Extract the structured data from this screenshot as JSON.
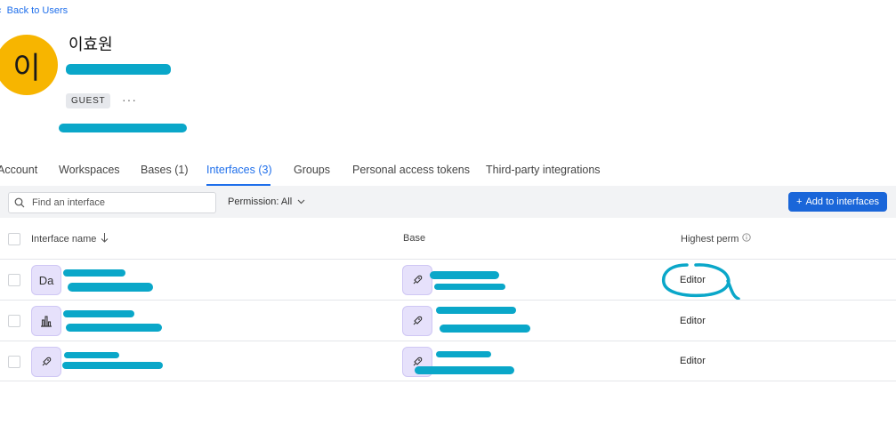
{
  "back_link": {
    "label": "Back to Users"
  },
  "user": {
    "avatar_initial": "이",
    "name": "이효원",
    "role_badge": "GUEST",
    "more_label": "···"
  },
  "tabs": [
    {
      "label": "Account"
    },
    {
      "label": "Workspaces"
    },
    {
      "label": "Bases (1)"
    },
    {
      "label": "Interfaces (3)",
      "active": true
    },
    {
      "label": "Groups"
    },
    {
      "label": "Personal access tokens"
    },
    {
      "label": "Third-party integrations"
    }
  ],
  "toolbar": {
    "search_placeholder": "Find an interface",
    "permission_filter": "Permission: All",
    "add_button": "Add to interfaces"
  },
  "table": {
    "headers": {
      "name": "Interface name",
      "base": "Base",
      "permission": "Highest perm"
    },
    "rows": [
      {
        "icon_text": "Da",
        "icon": "initials",
        "base_icon": "rocket-icon",
        "permission": "Editor"
      },
      {
        "icon_text": "",
        "icon": "bar-chart-icon",
        "base_icon": "rocket-icon",
        "permission": "Editor"
      },
      {
        "icon_text": "",
        "icon": "rocket-icon",
        "base_icon": "rocket-icon",
        "permission": "Editor"
      }
    ]
  },
  "colors": {
    "accent": "#1f6feb",
    "button": "#1a66d9",
    "avatar": "#f7b500",
    "redaction": "#0aa7c9",
    "tile": "#e6e1fb"
  }
}
